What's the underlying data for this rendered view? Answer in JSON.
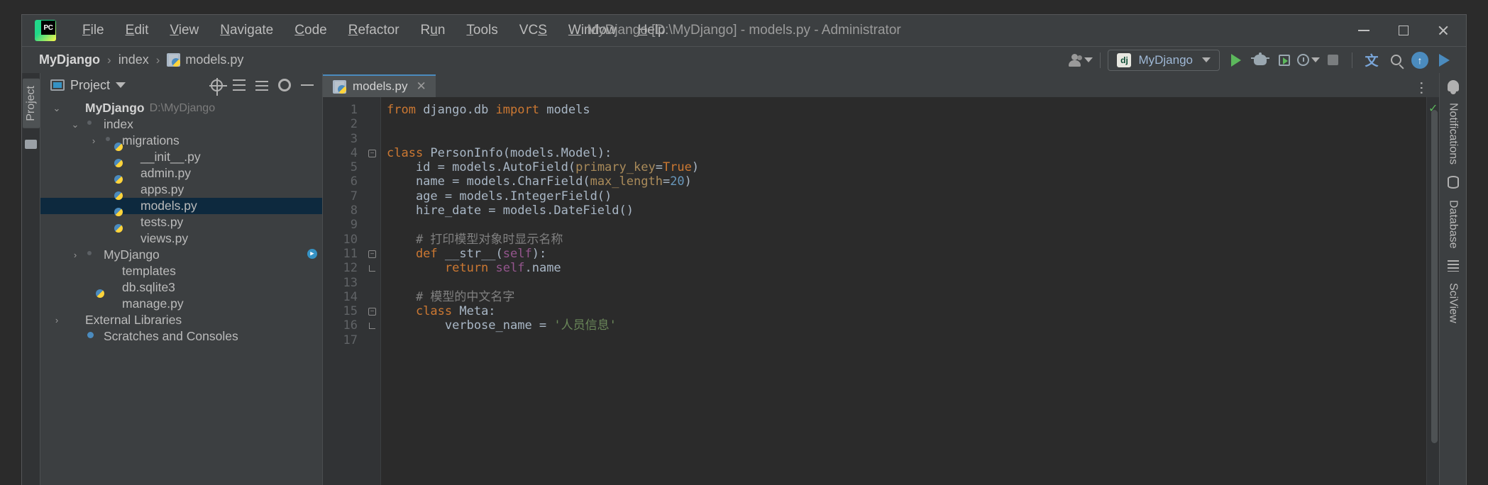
{
  "window": {
    "title": "MyDjango [D:\\MyDjango] - models.py - Administrator",
    "minimize_label": "–",
    "maximize_label": "□",
    "close_label": "✕"
  },
  "menubar": {
    "logo_text": "PC",
    "items": [
      {
        "label": "File",
        "mnemonic": "F"
      },
      {
        "label": "Edit",
        "mnemonic": "E"
      },
      {
        "label": "View",
        "mnemonic": "V"
      },
      {
        "label": "Navigate",
        "mnemonic": "N"
      },
      {
        "label": "Code",
        "mnemonic": "C"
      },
      {
        "label": "Refactor",
        "mnemonic": "R"
      },
      {
        "label": "Run",
        "mnemonic": "u"
      },
      {
        "label": "Tools",
        "mnemonic": "T"
      },
      {
        "label": "VCS",
        "mnemonic": "S"
      },
      {
        "label": "Window",
        "mnemonic": "W"
      },
      {
        "label": "Help",
        "mnemonic": "H"
      }
    ]
  },
  "breadcrumb": {
    "items": [
      {
        "label": "MyDjango",
        "icon": "none",
        "bold": true
      },
      {
        "label": "index",
        "icon": "none",
        "bold": false
      },
      {
        "label": "models.py",
        "icon": "python-file-icon",
        "bold": false
      }
    ],
    "separator": "›"
  },
  "toolbar": {
    "user_icon": "user-avatar-icon",
    "run_config": {
      "icon_text": "dj",
      "name": "MyDjango",
      "dropdown": "▾"
    },
    "actions": [
      {
        "name": "run-button",
        "icon": "play-icon"
      },
      {
        "name": "debug-button",
        "icon": "bug-icon"
      },
      {
        "name": "run-coverage-button",
        "icon": "run-coverage-icon"
      },
      {
        "name": "profile-button",
        "icon": "clock-icon"
      },
      {
        "name": "stop-button",
        "icon": "stop-icon"
      },
      {
        "name": "translate-button",
        "icon": "translate-icon",
        "glyph": "文"
      },
      {
        "name": "search-everywhere-button",
        "icon": "search-icon"
      },
      {
        "name": "update-project-button",
        "icon": "arrow-up-circle-icon",
        "glyph": "↑"
      },
      {
        "name": "ide-run-button",
        "icon": "play-blue-icon"
      }
    ]
  },
  "left_rail": {
    "tabs": [
      "Project"
    ],
    "structure_icon": "folder-icon"
  },
  "project_panel": {
    "title": "Project",
    "dropdown": "▾",
    "actions": [
      {
        "name": "select-opened-file-button",
        "icon": "target-icon"
      },
      {
        "name": "collapse-all-button",
        "icon": "collapse-all-icon"
      },
      {
        "name": "expand-all-button",
        "icon": "expand-all-icon"
      },
      {
        "name": "settings-button",
        "icon": "gear-icon"
      },
      {
        "name": "hide-button",
        "icon": "minus-icon"
      }
    ],
    "tree": [
      {
        "label": "MyDjango",
        "path": "D:\\MyDjango",
        "indent": 0,
        "arrow": "⌄",
        "icon": "folder-icon",
        "bold": true,
        "selected": false
      },
      {
        "label": "index",
        "path": "",
        "indent": 1,
        "arrow": "⌄",
        "icon": "module-folder-icon",
        "bold": false,
        "selected": false
      },
      {
        "label": "migrations",
        "path": "",
        "indent": 2,
        "arrow": "›",
        "icon": "module-folder-icon",
        "bold": false,
        "selected": false
      },
      {
        "label": "__init__.py",
        "path": "",
        "indent": 3,
        "arrow": "",
        "icon": "python-file-icon",
        "bold": false,
        "selected": false
      },
      {
        "label": "admin.py",
        "path": "",
        "indent": 3,
        "arrow": "",
        "icon": "python-file-icon",
        "bold": false,
        "selected": false
      },
      {
        "label": "apps.py",
        "path": "",
        "indent": 3,
        "arrow": "",
        "icon": "python-file-icon",
        "bold": false,
        "selected": false
      },
      {
        "label": "models.py",
        "path": "",
        "indent": 3,
        "arrow": "",
        "icon": "python-file-icon",
        "bold": false,
        "selected": true
      },
      {
        "label": "tests.py",
        "path": "",
        "indent": 3,
        "arrow": "",
        "icon": "python-file-icon",
        "bold": false,
        "selected": false
      },
      {
        "label": "views.py",
        "path": "",
        "indent": 3,
        "arrow": "",
        "icon": "python-file-icon",
        "bold": false,
        "selected": false
      },
      {
        "label": "MyDjango",
        "path": "",
        "indent": 1,
        "arrow": "›",
        "icon": "module-folder-icon",
        "bold": false,
        "selected": false
      },
      {
        "label": "templates",
        "path": "",
        "indent": 2,
        "arrow": "",
        "icon": "templates-folder-icon",
        "bold": false,
        "selected": false
      },
      {
        "label": "db.sqlite3",
        "path": "",
        "indent": 2,
        "arrow": "",
        "icon": "database-file-icon",
        "bold": false,
        "selected": false
      },
      {
        "label": "manage.py",
        "path": "",
        "indent": 2,
        "arrow": "",
        "icon": "python-file-icon",
        "bold": false,
        "selected": false
      },
      {
        "label": "External Libraries",
        "path": "",
        "indent": 0,
        "arrow": "›",
        "icon": "libraries-icon",
        "bold": false,
        "selected": false
      },
      {
        "label": "Scratches and Consoles",
        "path": "",
        "indent": 1,
        "arrow": "",
        "icon": "scratches-icon",
        "bold": false,
        "selected": false
      }
    ]
  },
  "editor": {
    "tabs": [
      {
        "label": "models.py",
        "icon": "python-file-icon",
        "close": "✕",
        "active": true
      }
    ],
    "options_icon": "more-options-icon",
    "inspection_status": "✓",
    "line_numbers": [
      1,
      2,
      3,
      4,
      5,
      6,
      7,
      8,
      9,
      10,
      11,
      12,
      13,
      14,
      15,
      16,
      17
    ],
    "lines": [
      {
        "n": 1,
        "tokens": [
          {
            "t": "from ",
            "c": "kw"
          },
          {
            "t": "django.db ",
            "c": "cls"
          },
          {
            "t": "import ",
            "c": "kw"
          },
          {
            "t": "models",
            "c": "cls"
          }
        ]
      },
      {
        "n": 2,
        "tokens": []
      },
      {
        "n": 3,
        "tokens": []
      },
      {
        "n": 4,
        "tokens": [
          {
            "t": "class ",
            "c": "kw"
          },
          {
            "t": "PersonInfo(models.Model):",
            "c": "cls"
          }
        ],
        "fold": "start"
      },
      {
        "n": 5,
        "tokens": [
          {
            "t": "    id = models.AutoField(",
            "c": "cls"
          },
          {
            "t": "primary_key",
            "c": "param"
          },
          {
            "t": "=",
            "c": "cls"
          },
          {
            "t": "True",
            "c": "kw"
          },
          {
            "t": ")",
            "c": "cls"
          }
        ]
      },
      {
        "n": 6,
        "tokens": [
          {
            "t": "    name = models.CharField(",
            "c": "cls"
          },
          {
            "t": "max_length",
            "c": "param"
          },
          {
            "t": "=",
            "c": "cls"
          },
          {
            "t": "20",
            "c": "num"
          },
          {
            "t": ")",
            "c": "cls"
          }
        ]
      },
      {
        "n": 7,
        "tokens": [
          {
            "t": "    age = models.IntegerField()",
            "c": "cls"
          }
        ]
      },
      {
        "n": 8,
        "tokens": [
          {
            "t": "    hire_date = models.DateField()",
            "c": "cls"
          }
        ]
      },
      {
        "n": 9,
        "tokens": []
      },
      {
        "n": 10,
        "tokens": [
          {
            "t": "    # 打印模型对象时显示名称",
            "c": "cmt"
          }
        ]
      },
      {
        "n": 11,
        "tokens": [
          {
            "t": "    def ",
            "c": "kw"
          },
          {
            "t": "__str__",
            "c": "cls"
          },
          {
            "t": "(",
            "c": "cls"
          },
          {
            "t": "self",
            "c": "self"
          },
          {
            "t": "):",
            "c": "cls"
          }
        ],
        "fold": "start",
        "marker": "run-gutter-icon"
      },
      {
        "n": 12,
        "tokens": [
          {
            "t": "        return ",
            "c": "kw"
          },
          {
            "t": "self",
            "c": "self"
          },
          {
            "t": ".name",
            "c": "cls"
          }
        ],
        "fold": "end"
      },
      {
        "n": 13,
        "tokens": []
      },
      {
        "n": 14,
        "tokens": [
          {
            "t": "    # 模型的中文名字",
            "c": "cmt"
          }
        ]
      },
      {
        "n": 15,
        "tokens": [
          {
            "t": "    class ",
            "c": "kw"
          },
          {
            "t": "Meta:",
            "c": "cls"
          }
        ],
        "fold": "start"
      },
      {
        "n": 16,
        "tokens": [
          {
            "t": "        verbose_name = ",
            "c": "cls"
          },
          {
            "t": "'人员信息'",
            "c": "str"
          }
        ],
        "fold": "end"
      },
      {
        "n": 17,
        "tokens": []
      }
    ]
  },
  "right_rail": {
    "tabs": [
      "Notifications",
      "Database",
      "SciView"
    ],
    "bell_icon": "notifications-bell-icon"
  }
}
